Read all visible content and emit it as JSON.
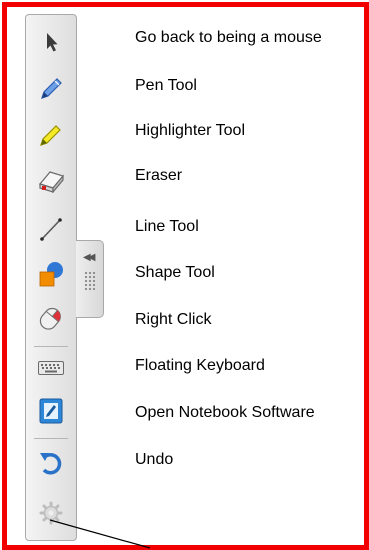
{
  "tools": [
    {
      "icon": "arrow-pointer-icon",
      "label": "Go back to being a mouse"
    },
    {
      "icon": "pen-icon",
      "label": "Pen Tool"
    },
    {
      "icon": "highlighter-icon",
      "label": "Highlighter Tool"
    },
    {
      "icon": "eraser-icon",
      "label": "Eraser"
    },
    {
      "icon": "line-tool-icon",
      "label": "Line Tool"
    },
    {
      "icon": "shape-tool-icon",
      "label": "Shape Tool"
    },
    {
      "icon": "mouse-right-click-icon",
      "label": "Right Click"
    },
    {
      "icon": "keyboard-icon",
      "label": "Floating Keyboard"
    },
    {
      "icon": "notebook-icon",
      "label": "Open Notebook Software"
    },
    {
      "icon": "undo-icon",
      "label": "Undo"
    },
    {
      "icon": "settings-icon",
      "label": ""
    }
  ],
  "colors": {
    "frame": "#f20000",
    "pen": "#3b6fd4",
    "highlighter": "#f2e500",
    "shape_orange": "#f28c00",
    "shape_blue": "#2f78d6",
    "undo": "#2a72c8",
    "notebook": "#2d86d6"
  }
}
